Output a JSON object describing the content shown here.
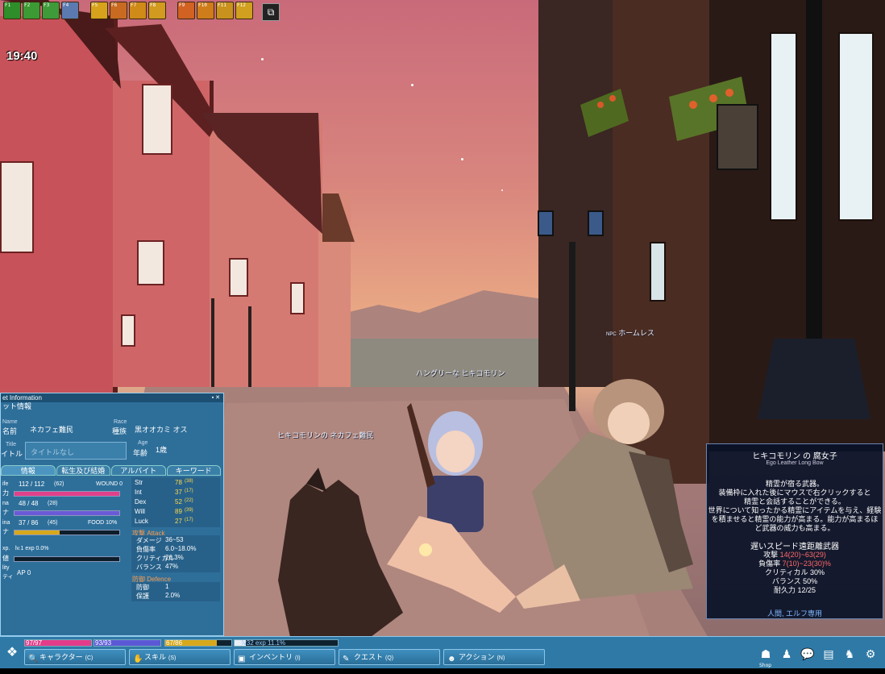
{
  "hud": {
    "clock": "19:40",
    "hotbar_keys": [
      "F1",
      "F2",
      "F3",
      "F4",
      "F5",
      "F6",
      "F7",
      "F8",
      "F9",
      "F10",
      "F11",
      "F12"
    ],
    "hotbar_colors": [
      "#2f8d2a",
      "#3b9a33",
      "#3f9b3a",
      "#5b7ab0",
      "#d7a21c",
      "#c86a20",
      "#cf8a18",
      "#d29a1e",
      "#d16222",
      "#cf7c1a",
      "#c9921c",
      "#d0a01e"
    ]
  },
  "nameplates": {
    "npc_tag": "NPC",
    "npc_name": "ホームレス",
    "pet_name": "ハングリーな ヒキコモリン",
    "player_name": "ヒキコモリンの ネカフェ難民"
  },
  "char_panel": {
    "title": "et Information",
    "subtitle": "ット情報",
    "name_en": "Name",
    "name_jp": "名前",
    "name_value": "ネカフェ難民",
    "race_en": "Race",
    "race_jp": "種族",
    "race_value": "黒オオカミ オス",
    "title_en": "Title",
    "title_jp": "イトル",
    "title_value": "タイトルなし",
    "age_en": "Age",
    "age_jp": "年齢",
    "age_value": "1歳",
    "tabs": [
      "情報",
      "転生及び結婚",
      "アルバイト",
      "キーワード"
    ],
    "life_label": "ife",
    "life_jp": "力",
    "life_value": "112 / 112",
    "life_extra": "(62)",
    "life_fill": 1.0,
    "wound": "WOUND 0",
    "mana_label": "na",
    "mana_jp": "ナ",
    "mana_value": "48 / 48",
    "mana_extra": "(28)",
    "mana_fill": 1.0,
    "stamina_label": "ina",
    "stamina_jp": "ナ",
    "stamina_value": "37 / 86",
    "stamina_extra": "(45)",
    "stamina_fill": 0.43,
    "food": "FOOD 10%",
    "exp_label": "xp.",
    "exp_line": "lv.1 exp 0.0%",
    "exp_jp": "値",
    "ability_label": "lity",
    "ability_jp": "ティ",
    "ap": "AP 0",
    "stats": [
      {
        "k": "Str",
        "v": "78",
        "x": "(38)"
      },
      {
        "k": "Int",
        "v": "37",
        "x": "(17)"
      },
      {
        "k": "Dex",
        "v": "52",
        "x": "(22)"
      },
      {
        "k": "Will",
        "v": "89",
        "x": "(39)"
      },
      {
        "k": "Luck",
        "v": "27",
        "x": "(17)"
      }
    ],
    "attack_header": "攻撃 Attack",
    "attack": [
      {
        "k": "ダメージ",
        "v": "36~53"
      },
      {
        "k": "負傷率",
        "v": "6.0~18.0%"
      },
      {
        "k": "クリティカル",
        "v": "26.3%"
      },
      {
        "k": "バランス",
        "v": "47%"
      }
    ],
    "defence_header": "防御 Defence",
    "defence": [
      {
        "k": "防御",
        "v": "1"
      },
      {
        "k": "保護",
        "v": "2.0%"
      }
    ]
  },
  "tooltip": {
    "title": "ヒキコモリン の 腐女子",
    "subtitle": "Ego Leather Long Bow",
    "desc": [
      "精霊が宿る武器。",
      "装備枠に入れた後にマウスで右クリックすると",
      "精霊と会話することができる。",
      "世界について知ったかる精霊にアイテムを与え、経験",
      "を積ませると精霊の能力が高まる。能力が高まるほ",
      "ど武器の威力も高まる。"
    ],
    "type": "遅いスピード遠距離武器",
    "attack_label": "攻撃",
    "attack_val": "14(20)~63(29)",
    "injury_label": "負傷率",
    "injury_val": "7(10)~23(30)%",
    "crit": "クリティカル 30%",
    "balance": "バランス 50%",
    "durability": "耐久力 12/25",
    "restriction": "人間, エルフ専用"
  },
  "bottom": {
    "hp_text": "97/97",
    "mp_text": "93/93",
    "sp_text": "67/86",
    "exp_text": "lv32 exp 11.1%",
    "hp_fill": 1.0,
    "mp_fill": 1.0,
    "sp_fill": 0.78,
    "exp_fill": 0.11,
    "buttons": [
      {
        "label": "キャラクター",
        "key": "(C)"
      },
      {
        "label": "スキル",
        "key": "(S)"
      },
      {
        "label": "インベントリ",
        "key": "(I)"
      },
      {
        "label": "クエスト",
        "key": "(Q)"
      },
      {
        "label": "アクション",
        "key": "(N)"
      }
    ],
    "shop": "Shop"
  }
}
